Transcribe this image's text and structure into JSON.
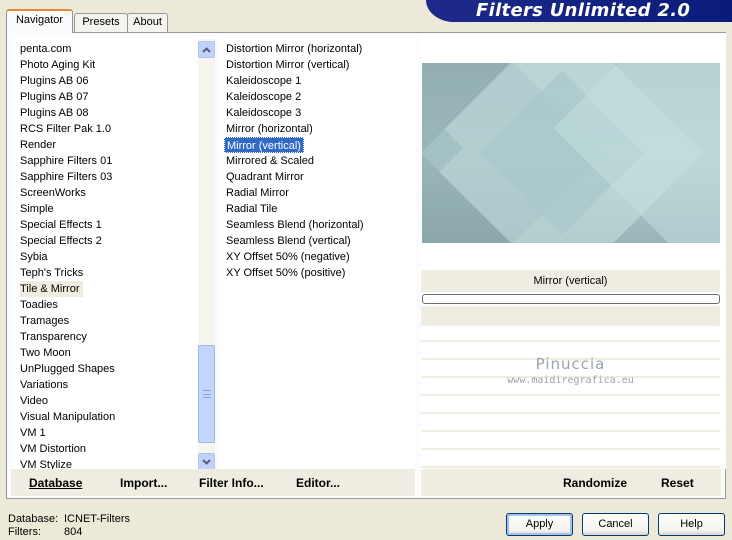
{
  "tabs": [
    "Navigator",
    "Presets",
    "About"
  ],
  "banner": "Filters Unlimited 2.0",
  "categories": [
    "penta.com",
    "Photo Aging Kit",
    "Plugins AB 06",
    "Plugins AB 07",
    "Plugins AB 08",
    "RCS Filter Pak 1.0",
    "Render",
    "Sapphire Filters 01",
    "Sapphire Filters 03",
    "ScreenWorks",
    "Simple",
    "Special Effects 1",
    "Special Effects 2",
    "Sybia",
    "Teph's Tricks",
    "Tile & Mirror",
    "Toadies",
    "Tramages",
    "Transparency",
    "Two Moon",
    "UnPlugged Shapes",
    "Variations",
    "Video",
    "Visual Manipulation",
    "VM 1",
    "VM Distortion",
    "VM Stylize"
  ],
  "selected_category": "Tile & Mirror",
  "filters": [
    "Distortion Mirror (horizontal)",
    "Distortion Mirror (vertical)",
    "Kaleidoscope 1",
    "Kaleidoscope 2",
    "Kaleidoscope 3",
    "Mirror (horizontal)",
    "Mirror (vertical)",
    "Mirrored & Scaled",
    "Quadrant Mirror",
    "Radial Mirror",
    "Radial Tile",
    "Seamless Blend (horizontal)",
    "Seamless Blend (vertical)",
    "XY Offset 50% (negative)",
    "XY Offset 50% (positive)"
  ],
  "selected_filter": "Mirror (vertical)",
  "preview_filter_name": "Mirror (vertical)",
  "watermark": {
    "name": "Pinuccia",
    "url": "www.maidiregrafica.eu"
  },
  "left_buttons": {
    "database": "Database",
    "import": "Import...",
    "filter_info": "Filter Info...",
    "editor": "Editor..."
  },
  "right_buttons": {
    "randomize": "Randomize",
    "reset": "Reset"
  },
  "status": {
    "database_label": "Database:",
    "database_value": "ICNET-Filters",
    "filters_label": "Filters:",
    "filters_value": "804"
  },
  "dialog": {
    "apply": "Apply",
    "cancel": "Cancel",
    "help": "Help"
  },
  "colors": {
    "selection": "#316ac5",
    "banner": "#0a1b79",
    "preview": "#a9c3c6"
  },
  "icons": {
    "scroll_up": "arrow-up-icon",
    "scroll_down": "arrow-down-icon"
  }
}
